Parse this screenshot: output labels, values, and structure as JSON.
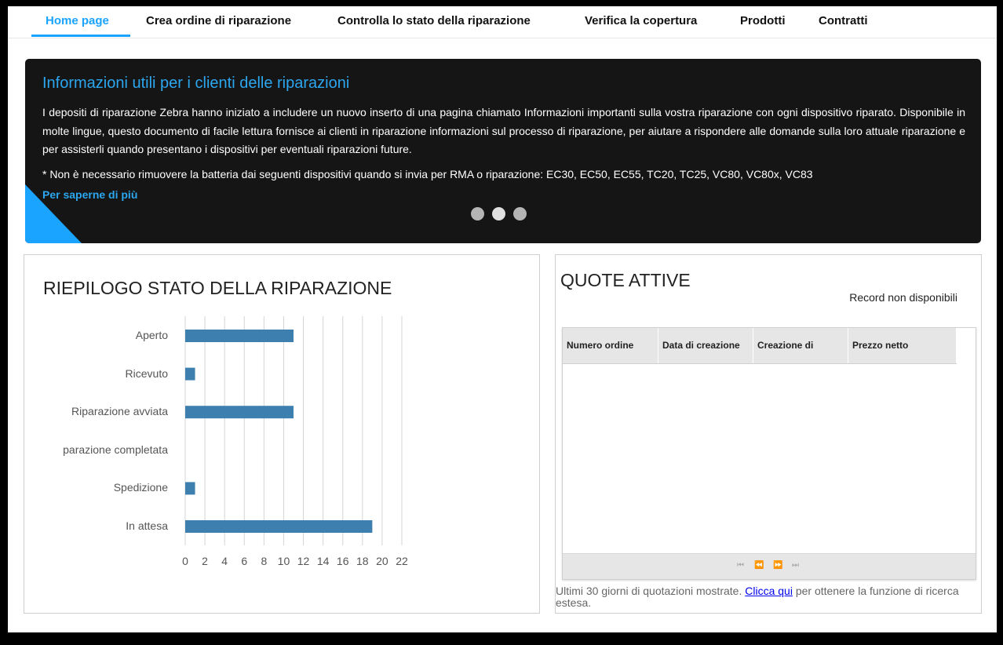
{
  "nav": {
    "items": [
      {
        "label": "Home page",
        "active": true
      },
      {
        "label": "Crea ordine di riparazione"
      },
      {
        "label": "Controlla lo stato della riparazione"
      },
      {
        "label": "Verifica la copertura"
      },
      {
        "label": "Prodotti"
      },
      {
        "label": "Contratti"
      }
    ]
  },
  "banner": {
    "title": "Informazioni utili per i clienti delle riparazioni",
    "body": "I depositi di riparazione Zebra hanno iniziato a includere un nuovo inserto di una pagina chiamato Informazioni importanti sulla vostra riparazione con ogni dispositivo riparato. Disponibile in molte lingue, questo documento di facile lettura fornisce ai clienti in riparazione informazioni sul processo di riparazione, per aiutare a rispondere alle domande sulla loro attuale riparazione e per assisterli quando presentano i dispositivi per eventuali riparazioni future.",
    "note": "* Non è necessario rimuovere la batteria dai seguenti dispositivi quando si invia per RMA o riparazione: EC30, EC50, EC55, TC20, TC25, VC80, VC80x, VC83",
    "link": "Per saperne di più",
    "dots": 3,
    "active_dot": 1
  },
  "repair_summary": {
    "title": "RIEPILOGO STATO DELLA RIPARAZIONE"
  },
  "chart_data": {
    "type": "bar",
    "orientation": "horizontal",
    "categories": [
      "Aperto",
      "Ricevuto",
      "Riparazione avviata",
      "parazione completata",
      "Spedizione",
      "In attesa"
    ],
    "values": [
      11,
      1,
      11,
      0,
      1,
      19
    ],
    "xlim": [
      0,
      22
    ],
    "xticks": [
      0,
      2,
      4,
      6,
      8,
      10,
      12,
      14,
      16,
      18,
      20,
      22
    ],
    "grid": true,
    "bar_color": "#3d80b0"
  },
  "quotes": {
    "title": "QUOTE ATTIVE",
    "no_records": "Record non disponibili",
    "columns": [
      "Numero ordine",
      "Data di creazione",
      "Creazione di",
      "Prezzo netto"
    ],
    "pager": [
      "⏮",
      "⏪",
      "⏩",
      "⏭"
    ],
    "footnote_prefix": "Ultimi 30  giorni di quotazioni mostrate. ",
    "footnote_link": "Clicca qui",
    "footnote_suffix": " per ottenere la funzione di ricerca estesa."
  },
  "colors": {
    "accent": "#1aa3ff",
    "banner_bg": "#151515",
    "bar": "#3d80b0"
  }
}
